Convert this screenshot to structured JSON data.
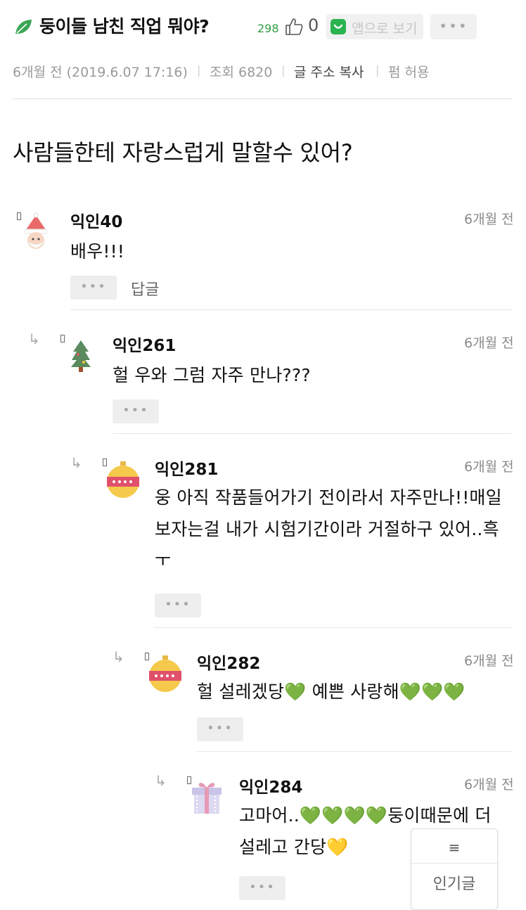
{
  "post": {
    "title": "둥이들 남친 직업 뭐야?",
    "like_count": "298",
    "dislike_count": "0",
    "app_button_label": "앱으로 보기",
    "more_label": "•••",
    "meta": {
      "time": "6개월 전 (2019.6.07 17:16)",
      "views": "조회 6820",
      "copy_link": "글 주소 복사",
      "share": "펌 허용"
    },
    "body": "사람들한테 자랑스럽게 말할수 있어?"
  },
  "comments": [
    {
      "nickname": "익인40",
      "time": "6개월 전",
      "text": "배우!!!",
      "more_label": "•••",
      "reply_label": "답글",
      "avatar": "santa-icon"
    },
    {
      "nickname": "익인261",
      "time": "6개월 전",
      "text": "헐 우와 그럼 자주 만나???",
      "more_label": "•••",
      "avatar": "christmas-tree-icon"
    },
    {
      "nickname": "익인281",
      "time": "6개월 전",
      "text": "웅 아직 작품들어가기 전이라서 자주만나!!매일보자는걸 내가 시험기간이라 거절하구 있어..흑ㅜ",
      "more_label": "•••",
      "avatar": "ornament-icon"
    },
    {
      "nickname": "익인282",
      "time": "6개월 전",
      "text": "헐 설레겠당💚 예쁜 사랑해💚💚💚",
      "more_label": "•••",
      "avatar": "ornament-icon"
    },
    {
      "nickname": "익인284",
      "time": "6개월 전",
      "text": "고마어..💚💚💚💚둥이때문에 더 설레고 간당💛",
      "more_label": "•••",
      "avatar": "gift-box-icon"
    }
  ],
  "floating_menu": {
    "icon": "≡",
    "label": "인기글"
  },
  "colors": {
    "accent_green": "#2bb34f",
    "like_green": "#2f9e44",
    "heart_green": "#39c24a",
    "heart_yellow": "#f2c230"
  }
}
